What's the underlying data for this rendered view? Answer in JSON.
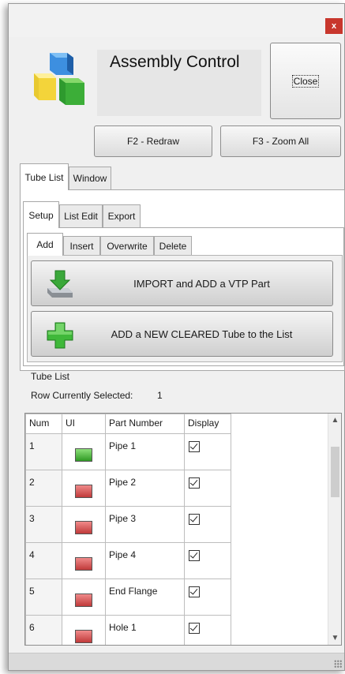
{
  "window": {
    "title": "Assembly Control",
    "close_x": "x",
    "close_button": "Close"
  },
  "toolbar": {
    "redraw_label": "F2 - Redraw",
    "zoom_all_label": "F3 - Zoom All"
  },
  "main_tabs": [
    {
      "label": "Tube List",
      "active": true
    },
    {
      "label": "Window",
      "active": false
    }
  ],
  "sub_tabs": [
    {
      "label": "Setup",
      "active": true
    },
    {
      "label": "List Edit",
      "active": false
    },
    {
      "label": "Export",
      "active": false
    }
  ],
  "action_tabs": [
    {
      "label": "Add",
      "active": true
    },
    {
      "label": "Insert",
      "active": false
    },
    {
      "label": "Overwrite",
      "active": false
    },
    {
      "label": "Delete",
      "active": false
    }
  ],
  "actions": {
    "import_label": "IMPORT and ADD a VTP Part",
    "import_icon": "import-arrow-icon",
    "add_new_label": "ADD a NEW CLEARED Tube to the List",
    "add_new_icon": "plus-icon"
  },
  "tube_list": {
    "heading": "Tube List",
    "selected_label": "Row Currently Selected:",
    "selected_value": "1",
    "columns": [
      "Num",
      "UI",
      "Part Number",
      "Display"
    ],
    "rows": [
      {
        "num": "1",
        "ui_color": "green",
        "part": "Pipe 1",
        "display": true
      },
      {
        "num": "2",
        "ui_color": "red",
        "part": "Pipe 2",
        "display": true
      },
      {
        "num": "3",
        "ui_color": "red",
        "part": "Pipe 3",
        "display": true
      },
      {
        "num": "4",
        "ui_color": "red",
        "part": "Pipe 4",
        "display": true
      },
      {
        "num": "5",
        "ui_color": "red",
        "part": "End Flange",
        "display": true
      },
      {
        "num": "6",
        "ui_color": "red",
        "part": "Hole 1",
        "display": true
      }
    ]
  },
  "colors": {
    "close_x_bg": "#c8372d",
    "ui_green": "#2f9a24",
    "ui_red": "#c03a3a",
    "plus_green": "#3fb83a"
  }
}
